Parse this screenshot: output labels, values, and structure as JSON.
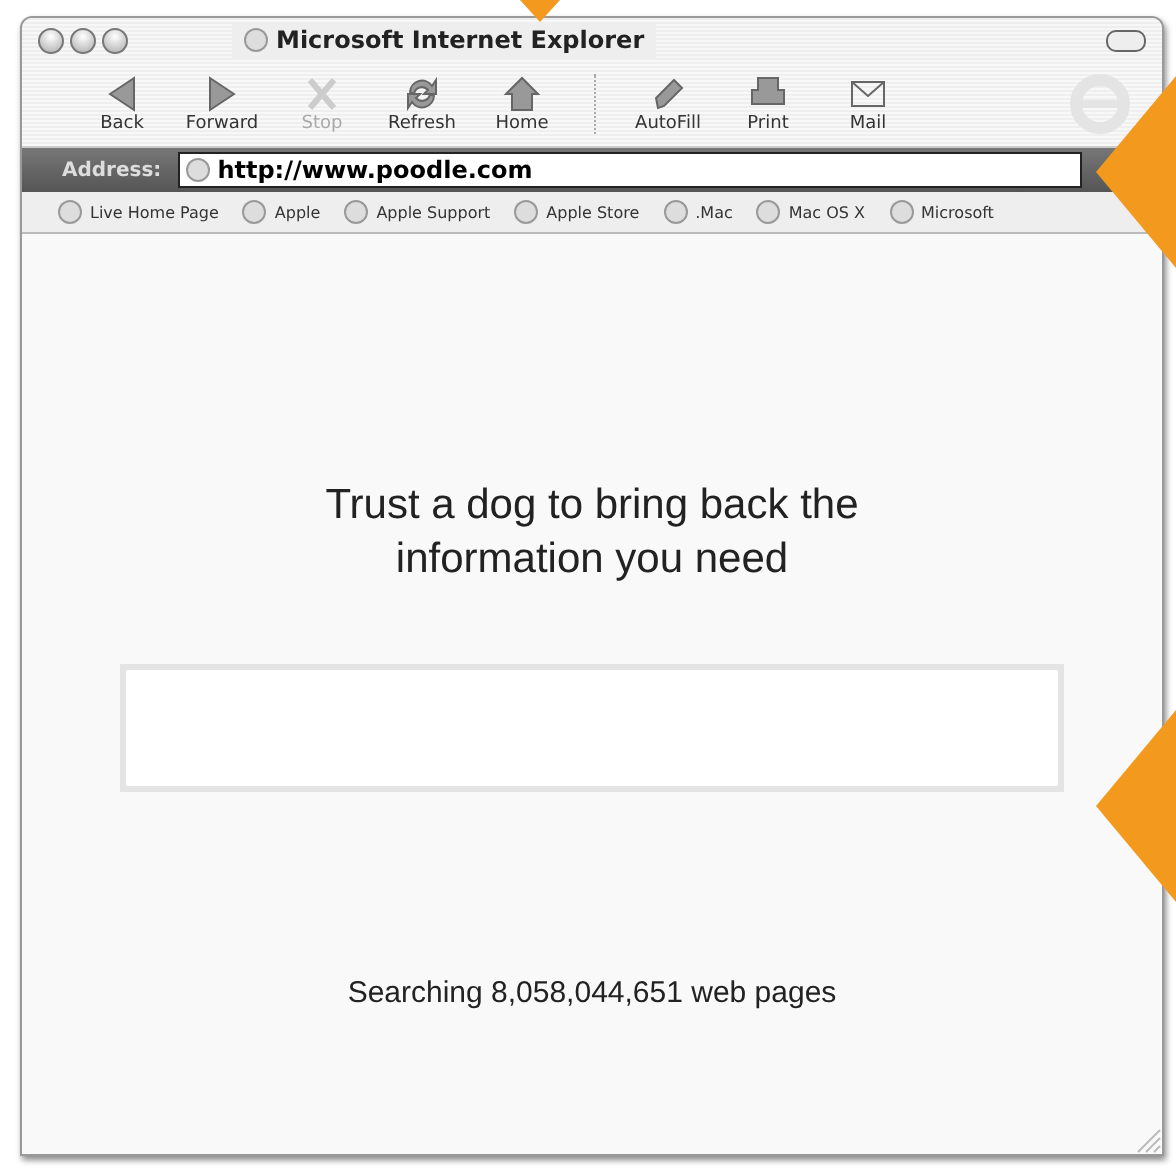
{
  "window": {
    "title": "Microsoft Internet Explorer"
  },
  "toolbar_groups": [
    [
      {
        "label": "Back",
        "disabled": false
      },
      {
        "label": "Forward",
        "disabled": false
      },
      {
        "label": "Stop",
        "disabled": true
      },
      {
        "label": "Refresh",
        "disabled": false
      },
      {
        "label": "Home",
        "disabled": false
      }
    ],
    [
      {
        "label": "AutoFill",
        "disabled": false
      },
      {
        "label": "Print",
        "disabled": false
      },
      {
        "label": "Mail",
        "disabled": false
      }
    ]
  ],
  "address": {
    "label": "Address:",
    "value": "http://www.poodle.com"
  },
  "favorites": [
    "Live Home Page",
    "Apple",
    "Apple Support",
    "Apple Store",
    ".Mac",
    "Mac OS X",
    "Microsoft"
  ],
  "page": {
    "headline": "Trust a dog to bring back the information you need",
    "footer": "Searching 8,058,044,651 web pages"
  }
}
